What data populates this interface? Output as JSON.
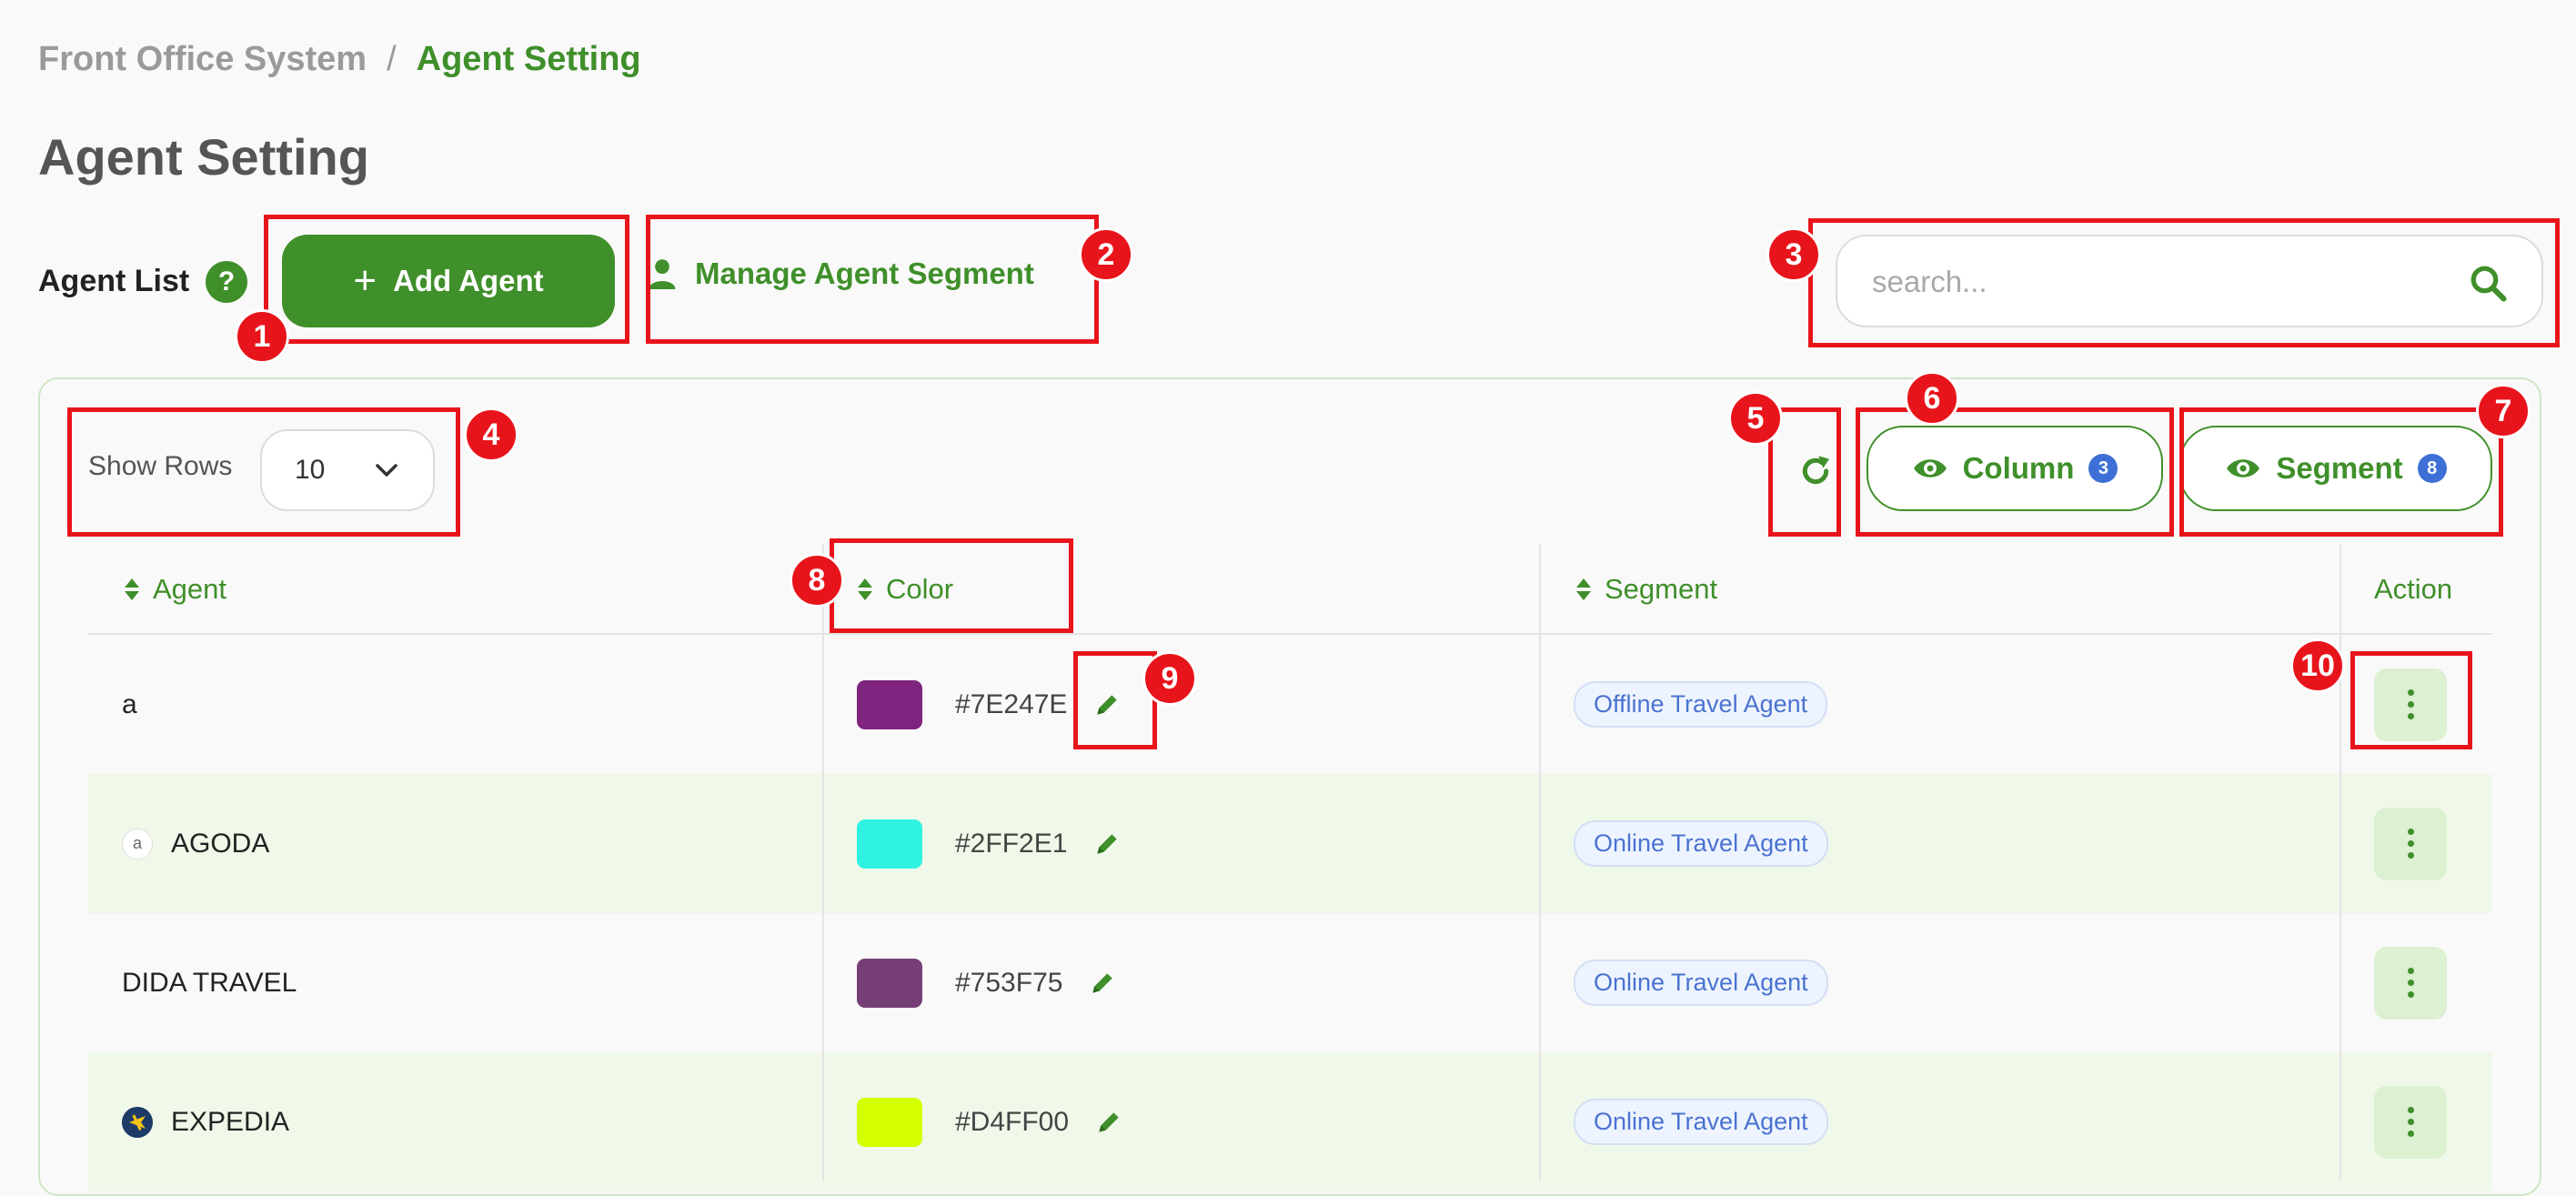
{
  "breadcrumb": {
    "root": "Front Office System",
    "separator": "/",
    "current": "Agent Setting"
  },
  "page_title": "Agent Setting",
  "toolbar": {
    "list_label": "Agent List",
    "help_glyph": "?",
    "add_icon": "+",
    "add_label": "Add Agent",
    "manage_label": "Manage Agent Segment"
  },
  "search": {
    "placeholder": "search...",
    "value": ""
  },
  "table_controls": {
    "show_rows_label": "Show Rows",
    "show_rows_value": "10",
    "column_label": "Column",
    "column_count": "3",
    "segment_label": "Segment",
    "segment_count": "8"
  },
  "columns": {
    "agent": "Agent",
    "color": "Color",
    "segment": "Segment",
    "action": "Action"
  },
  "rows": [
    {
      "agent": "a",
      "logo": "",
      "color_hex": "#7E247E",
      "segment": "Offline Travel Agent"
    },
    {
      "agent": "AGODA",
      "logo": "agoda-logo",
      "color_hex": "#2FF2E1",
      "segment": "Online Travel Agent"
    },
    {
      "agent": "DIDA TRAVEL",
      "logo": "",
      "color_hex": "#753F75",
      "segment": "Online Travel Agent"
    },
    {
      "agent": "EXPEDIA",
      "logo": "expedia-logo",
      "color_hex": "#D4FF00",
      "segment": "Online Travel Agent"
    }
  ],
  "logo_glyphs": {
    "agoda": "a"
  },
  "annotations": [
    "1",
    "2",
    "3",
    "4",
    "5",
    "6",
    "7",
    "8",
    "9",
    "10"
  ],
  "colors": {
    "brand_green": "#3f8f2a",
    "row_alt_bg": "#eff8e9",
    "badge_blue": "#3d6fd6",
    "annotation_red": "#e8141b"
  }
}
